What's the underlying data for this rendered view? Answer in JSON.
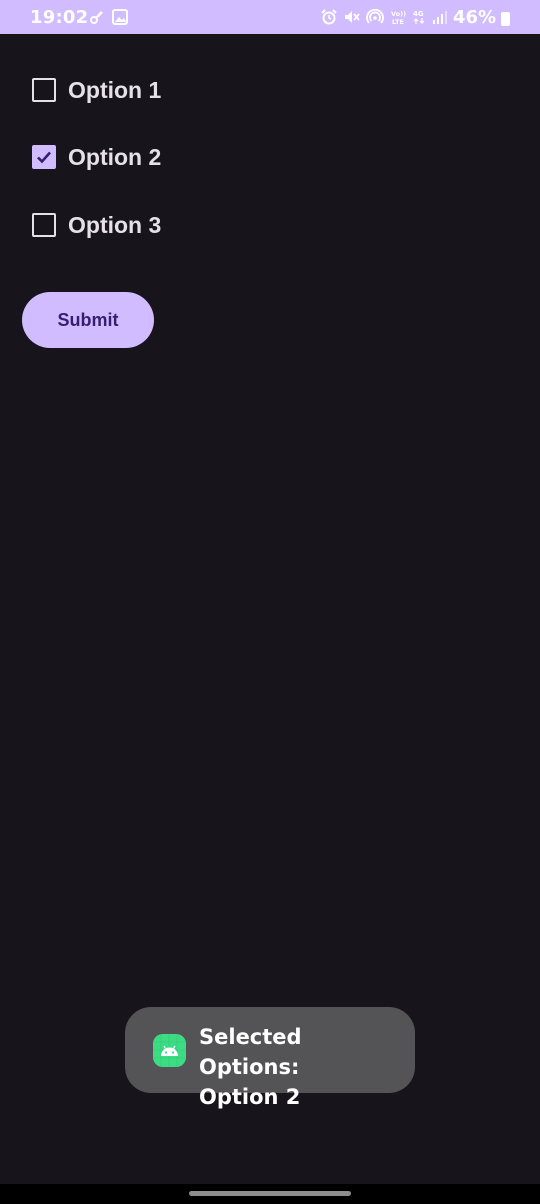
{
  "status_bar": {
    "time": "19:02",
    "battery": "46%",
    "background_color": "#d0bcfe",
    "left_icons": [
      "key-icon",
      "image-icon"
    ],
    "right_icons": [
      "alarm-icon",
      "mute-icon",
      "hotspot-icon",
      "volte-icon",
      "4g-icon",
      "signal-icon",
      "battery-icon"
    ]
  },
  "options": [
    {
      "label": "Option 1",
      "checked": false
    },
    {
      "label": "Option 2",
      "checked": true
    },
    {
      "label": "Option 3",
      "checked": false
    }
  ],
  "submit": {
    "label": "Submit"
  },
  "toast": {
    "line1": "Selected Options:",
    "line2": "Option 2",
    "icon": "android-app-icon"
  },
  "colors": {
    "background": "#17141c",
    "accent": "#d0bcfe",
    "text": "#e6e0e9",
    "toast_bg": "#545355"
  }
}
